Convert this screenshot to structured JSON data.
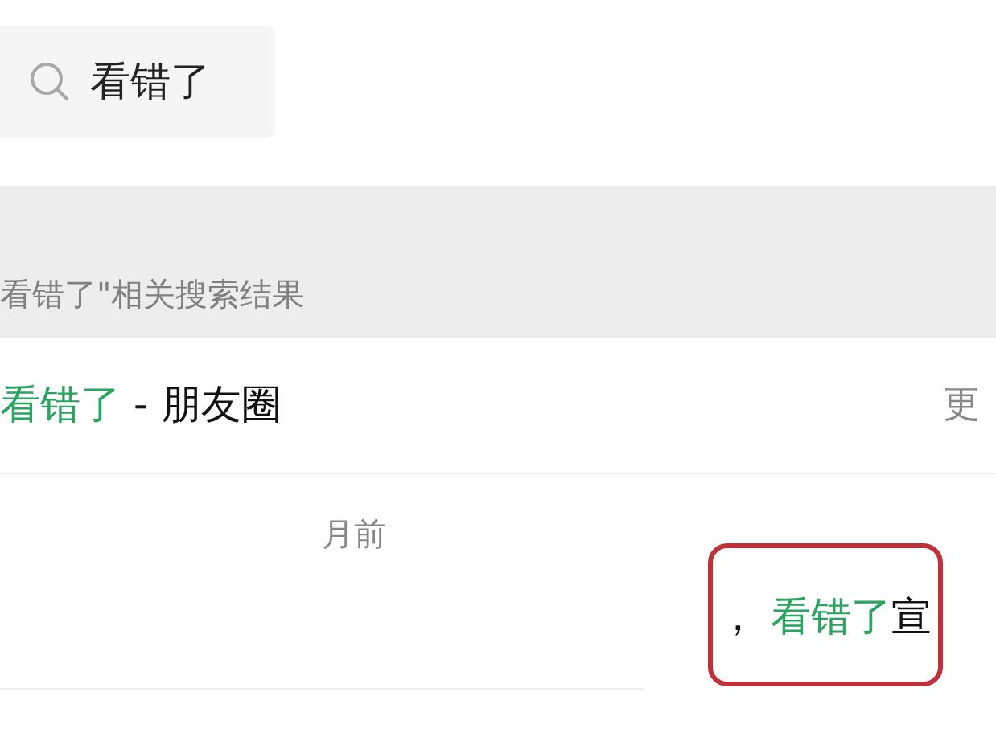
{
  "search": {
    "value": "看错了"
  },
  "section_header": "看错了\"相关搜索结果",
  "result_group": {
    "title_highlight": "看错了",
    "title_rest": " - 朋友圈",
    "more": "更"
  },
  "post": {
    "time": "月前",
    "snippet_before": "，",
    "snippet_highlight": "看错了",
    "snippet_after": "宣",
    "annotation": {
      "highlighted": true
    }
  }
}
